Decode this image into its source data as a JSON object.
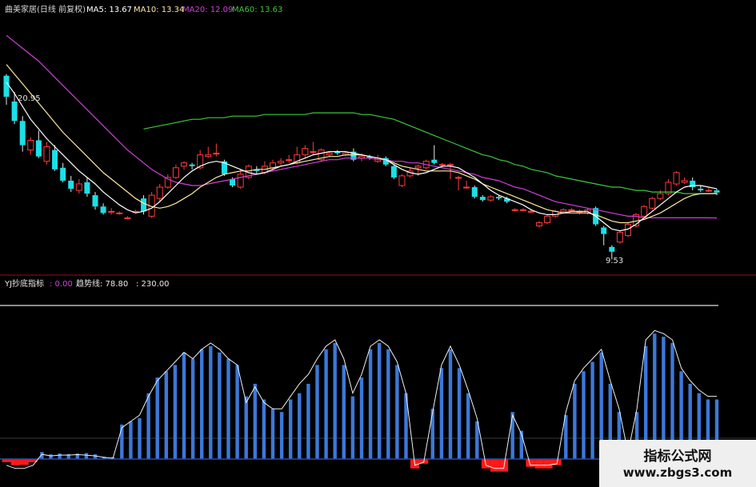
{
  "header": {
    "stock": "曲美家居(日线 前复权)",
    "ma5": "MA5: 13.67",
    "ma10": "MA10: 13.34",
    "ma20": "MA20: 12.09",
    "ma60": "MA60: 13.63"
  },
  "price_high_label": "20.95",
  "price_low_label": "9.53",
  "indicator": {
    "name": "YJ抄底指标",
    "value": ": 0.00",
    "trend_label": "趋势线: 78.80",
    "level": ": 230.00"
  },
  "watermark": {
    "title": "指标公式网",
    "url": "www.zbgs3.com"
  },
  "colors": {
    "up": "#ff3b3b",
    "down": "#1ae0e8",
    "ma5": "#ffffff",
    "ma10": "#ffe8a0",
    "ma20": "#d040d8",
    "ma60": "#3cc83c",
    "bar": "#3c78d8",
    "neg": "#ff1a1a"
  },
  "chart_data": [
    {
      "type": "candlestick",
      "candles": [
        [
          20.9,
          19.6,
          21.0,
          19.1
        ],
        [
          19.3,
          18.1,
          19.9,
          17.9
        ],
        [
          18.1,
          16.6,
          18.4,
          16.2
        ],
        [
          16.3,
          16.9,
          17.1,
          16.0
        ],
        [
          16.9,
          15.9,
          17.5,
          15.8
        ],
        [
          15.6,
          16.5,
          16.8,
          15.4
        ],
        [
          16.3,
          15.1,
          16.6,
          15.0
        ],
        [
          15.2,
          14.4,
          15.5,
          14.3
        ],
        [
          14.4,
          13.9,
          14.7,
          13.7
        ],
        [
          13.8,
          14.2,
          14.5,
          13.6
        ],
        [
          14.3,
          13.6,
          14.6,
          13.4
        ],
        [
          13.5,
          12.8,
          13.7,
          12.6
        ],
        [
          12.8,
          12.4,
          13.0,
          12.3
        ],
        [
          12.5,
          12.5,
          12.7,
          12.3
        ],
        [
          12.4,
          12.4,
          12.5,
          12.3
        ],
        [
          12.1,
          12.1,
          12.2,
          12.0
        ],
        [
          12.5,
          12.5,
          12.6,
          12.4
        ],
        [
          13.3,
          12.5,
          13.5,
          12.3
        ],
        [
          12.2,
          13.5,
          13.7,
          12.1
        ],
        [
          13.3,
          14.0,
          14.2,
          13.1
        ],
        [
          14.0,
          14.6,
          14.8,
          13.9
        ],
        [
          14.6,
          15.2,
          15.4,
          14.5
        ],
        [
          15.3,
          15.5,
          15.6,
          15.1
        ],
        [
          15.4,
          15.3,
          15.5,
          15.1
        ],
        [
          15.2,
          16.0,
          16.3,
          15.1
        ],
        [
          15.9,
          16.0,
          16.5,
          15.8
        ],
        [
          16.1,
          16.1,
          16.7,
          15.9
        ],
        [
          15.6,
          14.8,
          15.7,
          14.7
        ],
        [
          14.5,
          14.1,
          14.6,
          14.0
        ],
        [
          14.0,
          14.8,
          15.1,
          13.9
        ],
        [
          14.6,
          15.3,
          15.4,
          14.5
        ],
        [
          15.1,
          15.0,
          15.3,
          14.8
        ],
        [
          14.9,
          15.3,
          15.6,
          14.8
        ],
        [
          15.2,
          15.5,
          15.7,
          15.0
        ],
        [
          15.5,
          15.6,
          15.8,
          15.3
        ],
        [
          15.7,
          15.7,
          16.0,
          15.5
        ],
        [
          15.5,
          16.0,
          16.5,
          15.4
        ],
        [
          16.0,
          16.4,
          16.6,
          15.8
        ],
        [
          16.2,
          16.2,
          16.8,
          16.0
        ],
        [
          15.7,
          16.3,
          16.4,
          15.6
        ],
        [
          16.0,
          16.1,
          16.2,
          15.9
        ],
        [
          16.2,
          16.1,
          16.3,
          16.0
        ],
        [
          16.0,
          16.1,
          16.2,
          15.9
        ],
        [
          16.2,
          15.7,
          16.4,
          15.6
        ],
        [
          15.8,
          15.9,
          16.1,
          15.6
        ],
        [
          15.9,
          15.8,
          16.0,
          15.7
        ],
        [
          15.6,
          15.8,
          16.0,
          15.5
        ],
        [
          15.8,
          15.4,
          15.9,
          15.3
        ],
        [
          15.3,
          14.6,
          15.4,
          14.5
        ],
        [
          14.1,
          14.7,
          14.8,
          14.0
        ],
        [
          14.7,
          15.0,
          15.2,
          14.6
        ],
        [
          15.2,
          15.3,
          15.4,
          14.7
        ],
        [
          15.2,
          15.6,
          15.7,
          15.1
        ],
        [
          15.7,
          15.5,
          16.6,
          15.4
        ],
        [
          15.4,
          15.4,
          15.5,
          15.2
        ],
        [
          15.4,
          15.4,
          15.5,
          14.5
        ],
        [
          14.6,
          14.6,
          14.7,
          13.8
        ],
        [
          14.0,
          14.0,
          14.4,
          13.9
        ],
        [
          14.0,
          13.4,
          14.1,
          13.3
        ],
        [
          13.4,
          13.2,
          13.5,
          13.1
        ],
        [
          13.2,
          13.4,
          13.5,
          13.1
        ],
        [
          13.4,
          13.3,
          13.5,
          13.2
        ],
        [
          13.3,
          13.1,
          13.4,
          13.0
        ],
        [
          12.6,
          12.6,
          12.7,
          12.5
        ],
        [
          12.6,
          12.6,
          12.7,
          12.5
        ],
        [
          12.5,
          12.5,
          12.6,
          12.4
        ],
        [
          11.6,
          11.8,
          11.9,
          11.5
        ],
        [
          11.8,
          12.2,
          12.3,
          11.7
        ],
        [
          12.2,
          12.5,
          12.6,
          12.1
        ],
        [
          12.5,
          12.6,
          12.7,
          12.4
        ],
        [
          12.6,
          12.6,
          12.7,
          12.5
        ],
        [
          12.5,
          12.5,
          12.6,
          12.3
        ],
        [
          12.4,
          12.6,
          12.7,
          12.3
        ],
        [
          12.7,
          11.7,
          12.8,
          11.6
        ],
        [
          11.5,
          11.1,
          11.6,
          10.4
        ],
        [
          10.3,
          10.0,
          10.4,
          9.53
        ],
        [
          10.6,
          11.2,
          11.3,
          10.5
        ],
        [
          11.0,
          11.7,
          11.8,
          10.9
        ],
        [
          11.6,
          12.3,
          12.4,
          11.5
        ],
        [
          12.2,
          12.8,
          12.9,
          12.1
        ],
        [
          12.7,
          13.3,
          13.4,
          12.6
        ],
        [
          13.3,
          13.6,
          13.8,
          13.2
        ],
        [
          13.6,
          14.3,
          14.5,
          13.5
        ],
        [
          14.2,
          14.9,
          15.0,
          14.1
        ],
        [
          14.3,
          14.4,
          14.6,
          14.2
        ],
        [
          14.4,
          14.0,
          14.6,
          13.8
        ],
        [
          13.9,
          13.8,
          14.1,
          13.7
        ],
        [
          13.8,
          13.8,
          14.0,
          13.7
        ],
        [
          13.8,
          13.67,
          13.9,
          13.5
        ]
      ],
      "ma5": [
        20.5,
        19.8,
        19.0,
        18.2,
        17.6,
        17.0,
        16.5,
        16.0,
        15.5,
        15.0,
        14.6,
        14.2,
        13.7,
        13.3,
        12.9,
        12.6,
        12.4,
        12.5,
        12.7,
        13.1,
        13.6,
        14.1,
        14.6,
        15.0,
        15.3,
        15.5,
        15.6,
        15.5,
        15.3,
        15.1,
        14.9,
        14.8,
        14.9,
        15.1,
        15.3,
        15.4,
        15.6,
        15.8,
        16.0,
        16.1,
        16.2,
        16.2,
        16.2,
        16.1,
        16.0,
        15.9,
        15.8,
        15.7,
        15.4,
        15.1,
        14.9,
        14.8,
        14.9,
        15.1,
        15.3,
        15.3,
        15.2,
        14.9,
        14.6,
        14.2,
        13.8,
        13.5,
        13.3,
        13.1,
        12.9,
        12.6,
        12.4,
        12.3,
        12.3,
        12.4,
        12.5,
        12.5,
        12.5,
        12.2,
        11.8,
        11.4,
        11.3,
        11.4,
        11.7,
        12.1,
        12.5,
        12.9,
        13.3,
        13.7,
        14.0,
        14.1,
        14.1,
        14.0,
        13.9
      ],
      "ma10": [
        21.6,
        21.0,
        20.4,
        19.8,
        19.2,
        18.6,
        18.0,
        17.4,
        16.9,
        16.4,
        15.9,
        15.4,
        14.9,
        14.5,
        14.1,
        13.7,
        13.3,
        13.0,
        12.8,
        12.7,
        12.8,
        13.0,
        13.3,
        13.6,
        14.0,
        14.3,
        14.6,
        14.8,
        14.9,
        15.0,
        15.0,
        15.1,
        15.1,
        15.2,
        15.3,
        15.4,
        15.5,
        15.6,
        15.7,
        15.8,
        15.9,
        15.9,
        16.0,
        16.0,
        16.0,
        15.9,
        15.8,
        15.7,
        15.5,
        15.3,
        15.2,
        15.1,
        15.0,
        15.0,
        15.0,
        15.0,
        14.9,
        14.7,
        14.5,
        14.2,
        14.0,
        13.8,
        13.6,
        13.4,
        13.2,
        13.0,
        12.8,
        12.6,
        12.5,
        12.4,
        12.4,
        12.4,
        12.4,
        12.3,
        12.1,
        11.9,
        11.8,
        11.8,
        11.9,
        12.0,
        12.2,
        12.4,
        12.7,
        13.0,
        13.3,
        13.5,
        13.6,
        13.6,
        13.6
      ],
      "ma20": [
        23.4,
        23.0,
        22.6,
        22.2,
        21.8,
        21.3,
        20.8,
        20.3,
        19.8,
        19.3,
        18.8,
        18.3,
        17.8,
        17.3,
        16.8,
        16.3,
        15.9,
        15.5,
        15.1,
        14.8,
        14.5,
        14.3,
        14.2,
        14.1,
        14.1,
        14.2,
        14.3,
        14.4,
        14.5,
        14.6,
        14.7,
        14.8,
        14.9,
        15.0,
        15.1,
        15.2,
        15.3,
        15.4,
        15.5,
        15.6,
        15.7,
        15.7,
        15.8,
        15.8,
        15.8,
        15.8,
        15.7,
        15.7,
        15.6,
        15.6,
        15.5,
        15.5,
        15.4,
        15.3,
        15.2,
        15.1,
        15.0,
        14.9,
        14.8,
        14.6,
        14.5,
        14.4,
        14.2,
        14.0,
        13.9,
        13.7,
        13.5,
        13.3,
        13.1,
        13.0,
        12.9,
        12.8,
        12.7,
        12.6,
        12.5,
        12.4,
        12.3,
        12.2,
        12.2,
        12.1,
        12.1,
        12.1,
        12.1,
        12.1,
        12.1,
        12.1,
        12.1,
        12.1,
        12.09
      ],
      "ma60": [
        null,
        null,
        null,
        null,
        null,
        null,
        null,
        null,
        null,
        null,
        null,
        null,
        null,
        null,
        null,
        null,
        null,
        17.6,
        17.7,
        17.8,
        17.9,
        18.0,
        18.1,
        18.2,
        18.2,
        18.3,
        18.3,
        18.3,
        18.4,
        18.4,
        18.4,
        18.4,
        18.5,
        18.5,
        18.5,
        18.5,
        18.5,
        18.5,
        18.6,
        18.6,
        18.6,
        18.6,
        18.6,
        18.6,
        18.5,
        18.5,
        18.4,
        18.3,
        18.2,
        18.0,
        17.8,
        17.6,
        17.4,
        17.2,
        17.0,
        16.8,
        16.6,
        16.4,
        16.2,
        16.0,
        15.9,
        15.7,
        15.6,
        15.4,
        15.3,
        15.1,
        15.0,
        14.9,
        14.7,
        14.6,
        14.5,
        14.4,
        14.3,
        14.2,
        14.1,
        14.0,
        14.0,
        13.9,
        13.8,
        13.8,
        13.7,
        13.7,
        13.7,
        13.7,
        13.6,
        13.6,
        13.6,
        13.6,
        13.63
      ],
      "ylim": [
        9.0,
        24.5
      ]
    },
    {
      "type": "bar",
      "values": [
        -20,
        -40,
        -38,
        -20,
        45,
        30,
        35,
        32,
        35,
        38,
        30,
        15,
        12,
        220,
        240,
        260,
        420,
        520,
        560,
        600,
        680,
        640,
        700,
        720,
        680,
        640,
        600,
        400,
        480,
        380,
        320,
        300,
        380,
        420,
        480,
        600,
        700,
        740,
        600,
        400,
        520,
        700,
        740,
        700,
        600,
        420,
        -60,
        -30,
        320,
        580,
        700,
        580,
        420,
        240,
        -60,
        -80,
        -80,
        300,
        180,
        -50,
        -60,
        -60,
        -40,
        280,
        480,
        560,
        620,
        680,
        480,
        300,
        0,
        300,
        720,
        800,
        780,
        740,
        560,
        480,
        420,
        380,
        380
      ],
      "trend": [
        -40,
        -60,
        -60,
        -40,
        30,
        20,
        25,
        25,
        28,
        25,
        20,
        10,
        5,
        200,
        240,
        280,
        400,
        500,
        560,
        620,
        680,
        640,
        700,
        740,
        700,
        640,
        600,
        360,
        460,
        360,
        320,
        320,
        400,
        480,
        540,
        640,
        720,
        760,
        640,
        420,
        540,
        720,
        760,
        720,
        620,
        420,
        -40,
        -20,
        300,
        600,
        720,
        600,
        440,
        260,
        -40,
        -60,
        -60,
        280,
        160,
        -40,
        -40,
        -40,
        -30,
        300,
        500,
        580,
        640,
        700,
        500,
        320,
        40,
        320,
        760,
        820,
        800,
        760,
        580,
        500,
        440,
        400,
        400
      ],
      "ylim": [
        -120,
        1000
      ],
      "reference_lines": [
        0
      ]
    }
  ]
}
